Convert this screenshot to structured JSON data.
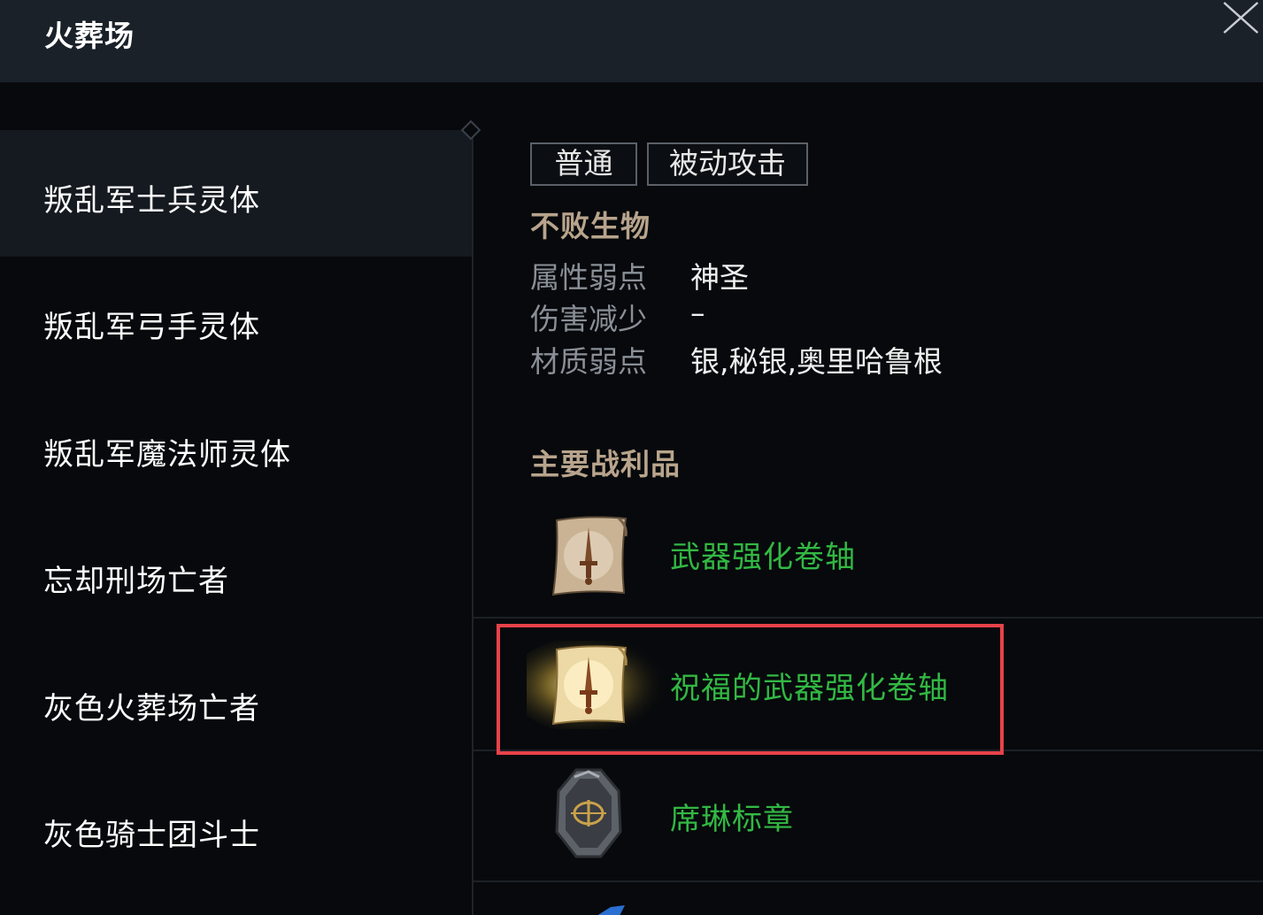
{
  "header": {
    "title": "火葬场"
  },
  "sidebar": {
    "items": [
      {
        "label": "叛乱军士兵灵体"
      },
      {
        "label": "叛乱军弓手灵体"
      },
      {
        "label": "叛乱军魔法师灵体"
      },
      {
        "label": "忘却刑场亡者"
      },
      {
        "label": "灰色火葬场亡者"
      },
      {
        "label": "灰色骑士团斗士"
      }
    ]
  },
  "monster": {
    "tags": [
      "普通",
      "被动攻击"
    ],
    "category": "不败生物",
    "attributes": [
      {
        "label": "属性弱点",
        "value": "神圣"
      },
      {
        "label": "伤害减少",
        "value": "–"
      },
      {
        "label": "材质弱点",
        "value": "银,秘银,奥里哈鲁根"
      }
    ]
  },
  "loot": {
    "title": "主要战利品",
    "items": [
      {
        "name": "武器强化卷轴",
        "icon": "weapon-scroll-icon"
      },
      {
        "name": "祝福的武器强化卷轴",
        "icon": "blessed-weapon-scroll-icon"
      },
      {
        "name": "席琳标章",
        "icon": "shilen-emblem-icon"
      }
    ]
  },
  "colors": {
    "loot_name": "#32b843",
    "section_title": "#b8a48c",
    "highlight": "#e8424a"
  }
}
